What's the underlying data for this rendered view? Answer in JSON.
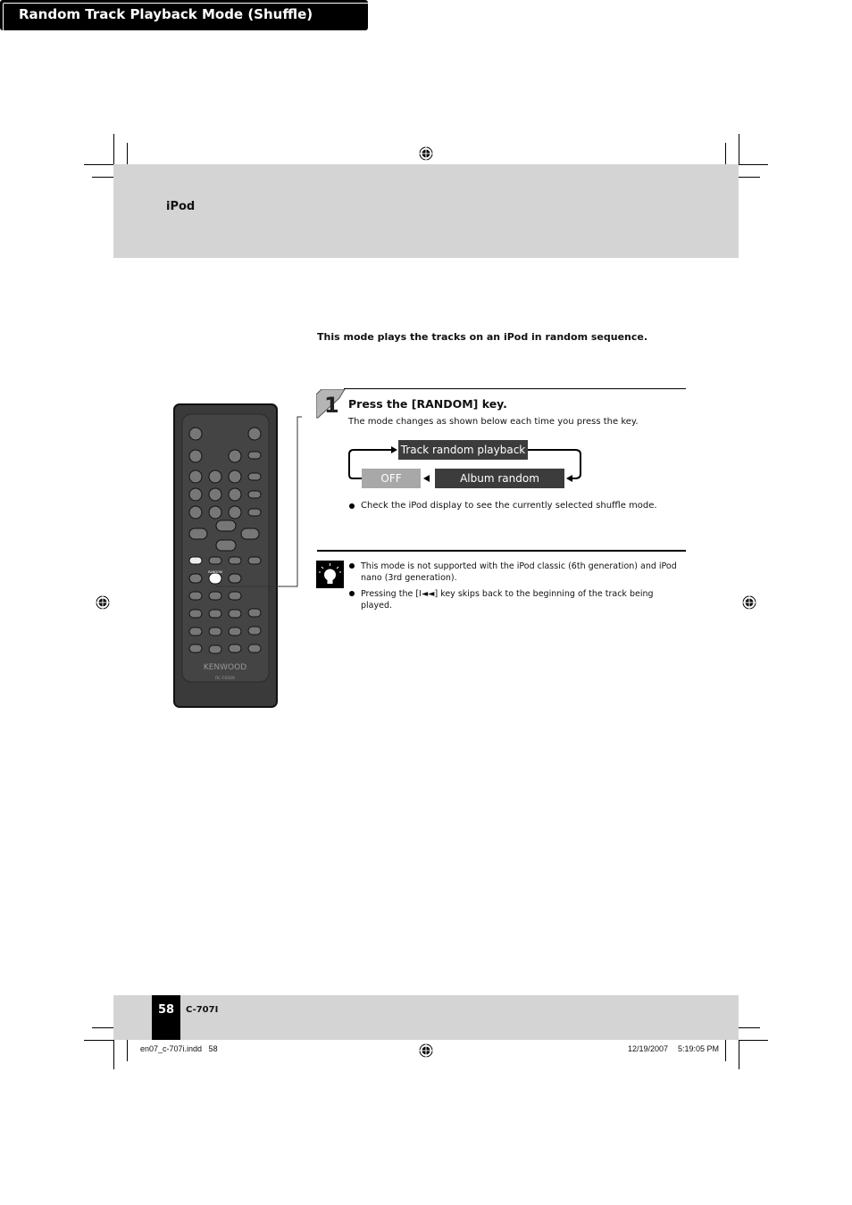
{
  "header": {
    "section": "iPod"
  },
  "title": "Random Track Playback Mode (Shuffle)",
  "intro": "This mode plays the tracks on an iPod in random sequence.",
  "step": {
    "number": "1",
    "heading": "Press the [RANDOM] key.",
    "description": "The mode changes as shown below each time you press the key.",
    "modes": {
      "track": "Track random playback",
      "album": "Album random playback",
      "off": "OFF"
    },
    "bullet": "Check the iPod display to see the currently selected shuffle mode."
  },
  "notes": [
    "This mode is not supported with the iPod classic (6th generation) and iPod nano (3rd generation).",
    "Pressing the [I◄◄] key skips back to the beginning of the track being played."
  ],
  "remote": {
    "brand": "KENWOOD",
    "model": "RC-F0509",
    "highlight_key": "RANDOM"
  },
  "footer": {
    "page": "58",
    "model": "C-707I",
    "file": "en07_c-707i.indd   58",
    "date": "12/19/2007",
    "time": "5:19:05 PM"
  },
  "colors": {
    "band": "#d4d4d4",
    "mode_box": "#3c3c3c",
    "off_box": "#a8a8a8"
  }
}
